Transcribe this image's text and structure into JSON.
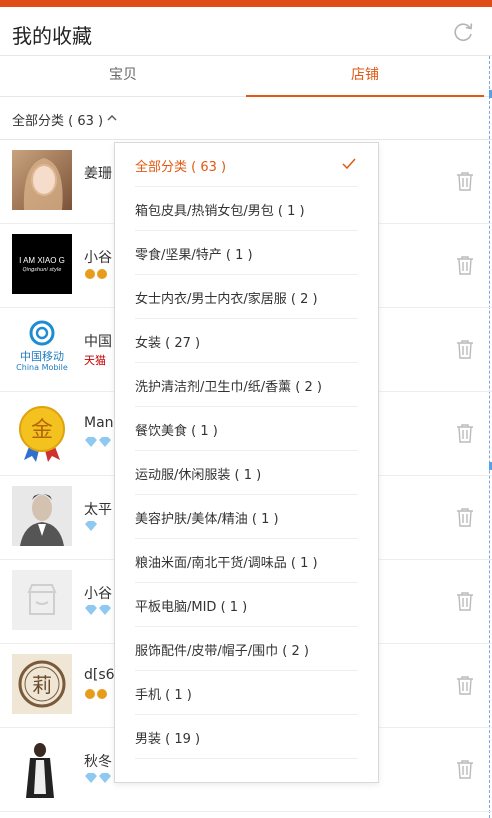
{
  "header": {
    "title": "我的收藏"
  },
  "tabs": [
    {
      "label": "宝贝"
    },
    {
      "label": "店铺"
    }
  ],
  "filter": {
    "label": "全部分类 ( 63 )"
  },
  "stores": [
    {
      "name": "姜珊"
    },
    {
      "name": "小谷"
    },
    {
      "name": "中国",
      "tag": "天猫"
    },
    {
      "name": "Man"
    },
    {
      "name": "太平"
    },
    {
      "name": "小谷"
    },
    {
      "name": "d[s6("
    },
    {
      "name": "秋冬"
    }
  ],
  "thumb_text": {
    "brand": "I AM XIAO G",
    "brand_sub": "Qingshuni style",
    "mobile_cn": "中国移动",
    "mobile_en": "China Mobile",
    "gold": "金",
    "seal": "莉"
  },
  "dropdown": {
    "items": [
      {
        "label": "全部分类 ( 63 )",
        "selected": true
      },
      {
        "label": "箱包皮具/热销女包/男包 ( 1 )"
      },
      {
        "label": "零食/坚果/特产 ( 1 )"
      },
      {
        "label": "女士内衣/男士内衣/家居服 ( 2 )"
      },
      {
        "label": "女装 ( 27 )"
      },
      {
        "label": "洗护清洁剂/卫生巾/纸/香薰 ( 2 )"
      },
      {
        "label": "餐饮美食 ( 1 )"
      },
      {
        "label": "运动服/休闲服装 ( 1 )"
      },
      {
        "label": "美容护肤/美体/精油 ( 1 )"
      },
      {
        "label": "粮油米面/南北干货/调味品 ( 1 )"
      },
      {
        "label": "平板电脑/MID ( 1 )"
      },
      {
        "label": "服饰配件/皮带/帽子/围巾 ( 2 )"
      },
      {
        "label": "手机 ( 1 )"
      },
      {
        "label": "男装 ( 19 )"
      }
    ]
  },
  "colors": {
    "accent": "#e05a14",
    "topbar": "#e04e17"
  }
}
